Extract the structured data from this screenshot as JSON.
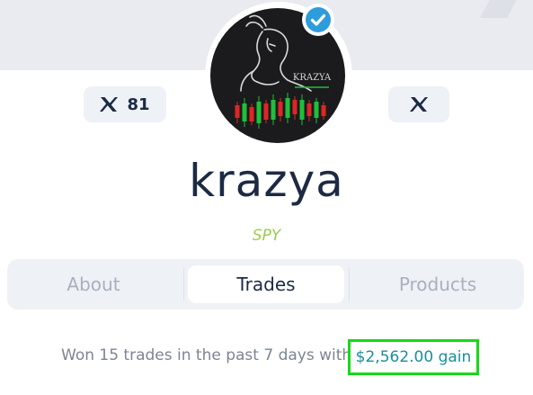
{
  "profile": {
    "username": "krazya",
    "ticker": "SPY",
    "avatar_text": "KRAZYA",
    "avatar_icon": "goat-candlestick-icon",
    "verified_icon": "verified-check-icon",
    "verified_color": "#2d9cdb"
  },
  "social": {
    "left": {
      "icon": "x-logo-icon",
      "count": "81"
    },
    "right": {
      "icon": "x-logo-icon",
      "count": ""
    }
  },
  "tabs": [
    {
      "label": "About",
      "active": false
    },
    {
      "label": "Trades",
      "active": true
    },
    {
      "label": "Products",
      "active": false
    }
  ],
  "summary": {
    "text": "Won 15 trades in the past 7 days with",
    "gain": "$2,562.00 gain",
    "gain_color": "#1a8f9c",
    "highlight_color": "#16d916"
  },
  "colors": {
    "banner": "#e9ebf1",
    "text_dark": "#1c2a44",
    "muted": "#a9b0bd",
    "candle_green": "#1fbf3a",
    "candle_red": "#e02525"
  }
}
